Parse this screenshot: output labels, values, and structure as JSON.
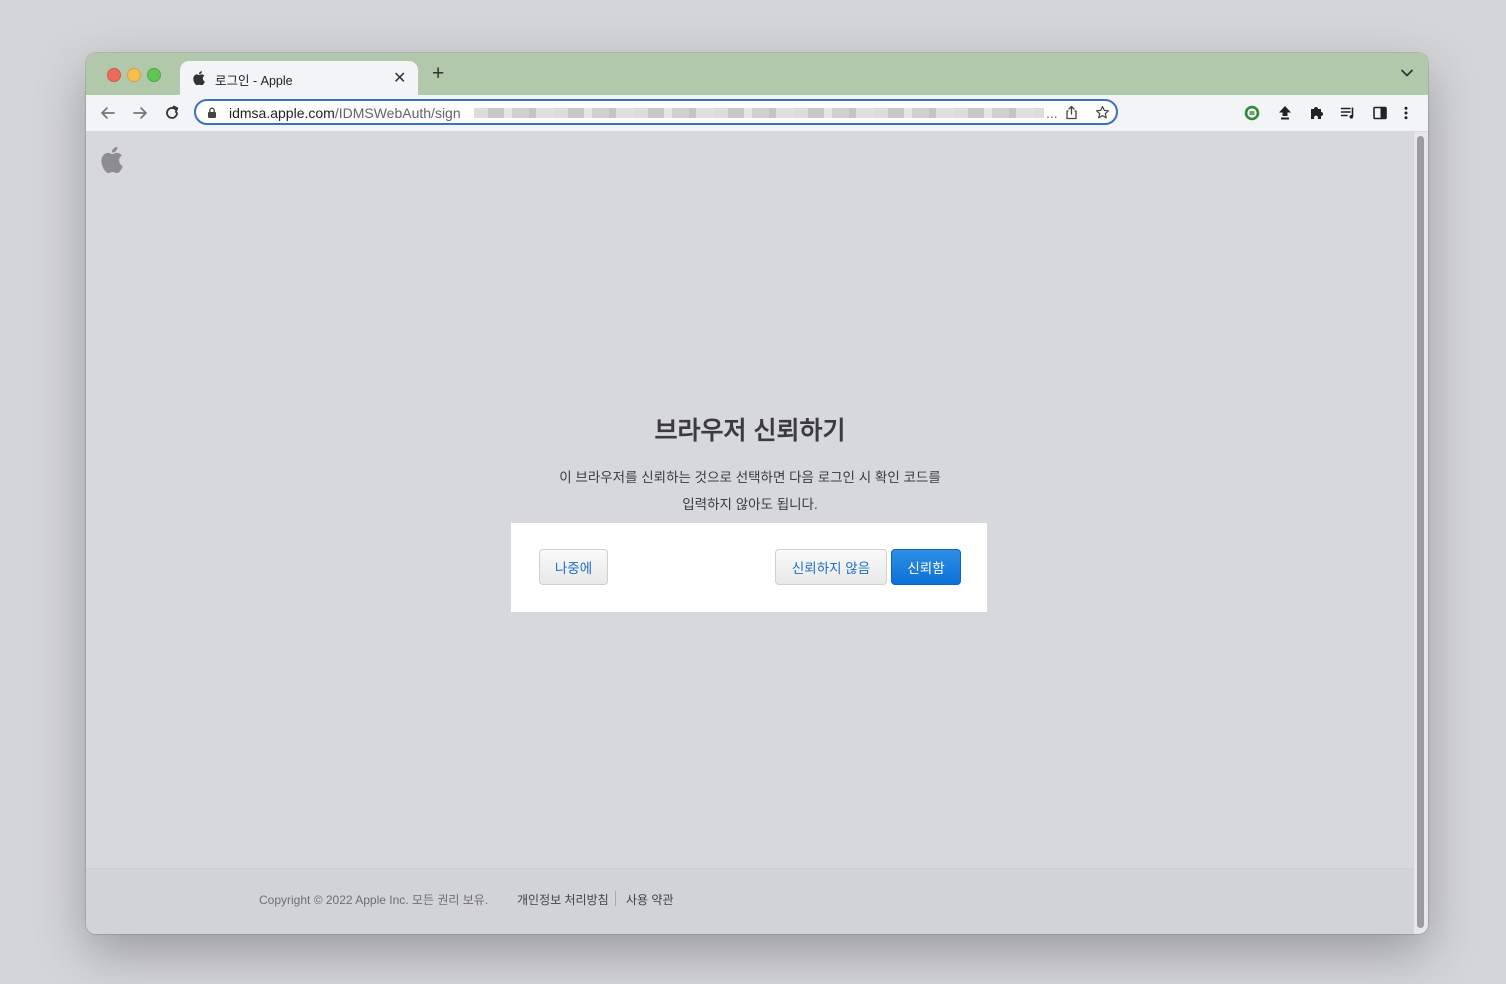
{
  "browser": {
    "tab": {
      "title": "로그인 - Apple"
    },
    "address_bar": {
      "host": "idmsa.apple.com",
      "path": "/IDMSWebAuth/sign",
      "ellipsis": "..."
    }
  },
  "page": {
    "title": "브라우저 신뢰하기",
    "description_line1": "이 브라우저를 신뢰하는 것으로 선택하면 다음 로그인 시 확인 코드를",
    "description_line2": "입력하지 않아도 됩니다.",
    "buttons": {
      "later": "나중에",
      "dont_trust": "신뢰하지 않음",
      "trust": "신뢰함"
    }
  },
  "footer": {
    "copyright": "Copyright © 2022 Apple Inc. 모든 권리 보유.",
    "privacy": "개인정보 처리방침",
    "terms": "사용 약관"
  },
  "colors": {
    "tabstrip": "#b1c8aa",
    "accent": "#0d70d6",
    "link": "#1c6fc7"
  }
}
